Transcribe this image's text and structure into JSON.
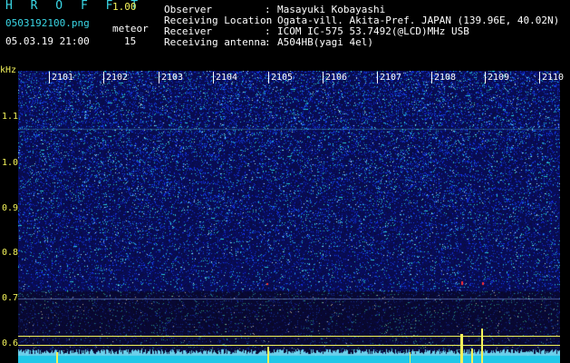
{
  "header": {
    "title": "H R O F F T",
    "version": "1.00",
    "file_name": "0503192100.png",
    "timestamp": "05.03.19 21:00",
    "meteor_label": "meteor",
    "meteor_count": "15"
  },
  "station": {
    "rows": [
      {
        "label": "Observer",
        "value": "Masayuki Kobayashi"
      },
      {
        "label": "Receiving Location",
        "value": "Ogata-vill. Akita-Pref. JAPAN (139.96E, 40.02N)"
      },
      {
        "label": "Receiver",
        "value": "ICOM IC-575 53.7492(@LCD)MHz USB"
      },
      {
        "label": "Receiving antenna",
        "value": "A504HB(yagi 4el)"
      }
    ],
    "separator": ":"
  },
  "axes": {
    "y_unit": "kHz",
    "y_ticks": [
      "1.1",
      "1.0",
      "0.9",
      "0.8",
      "0.7",
      "0.6"
    ],
    "x_ticks": [
      "2101",
      "2102",
      "2103",
      "2104",
      "2105",
      "2106",
      "2107",
      "2108",
      "2109",
      "2110"
    ]
  },
  "colors": {
    "header_cyan": "#3ad7e6",
    "axis_yellow": "#f2f25a",
    "background": "#000000"
  }
}
